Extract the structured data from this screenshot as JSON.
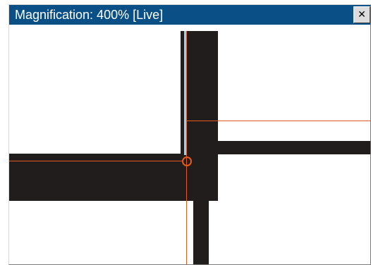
{
  "window": {
    "title": "Magnification: 400% [Live]",
    "close_label": "✕",
    "accent_color": "#0a4f85",
    "guide_color": "#e45a1c",
    "pixel_color": "#221d1d",
    "highlight_color": "#87d8f0"
  },
  "icons": {
    "close": "close-icon",
    "target": "crosshair-icon"
  }
}
